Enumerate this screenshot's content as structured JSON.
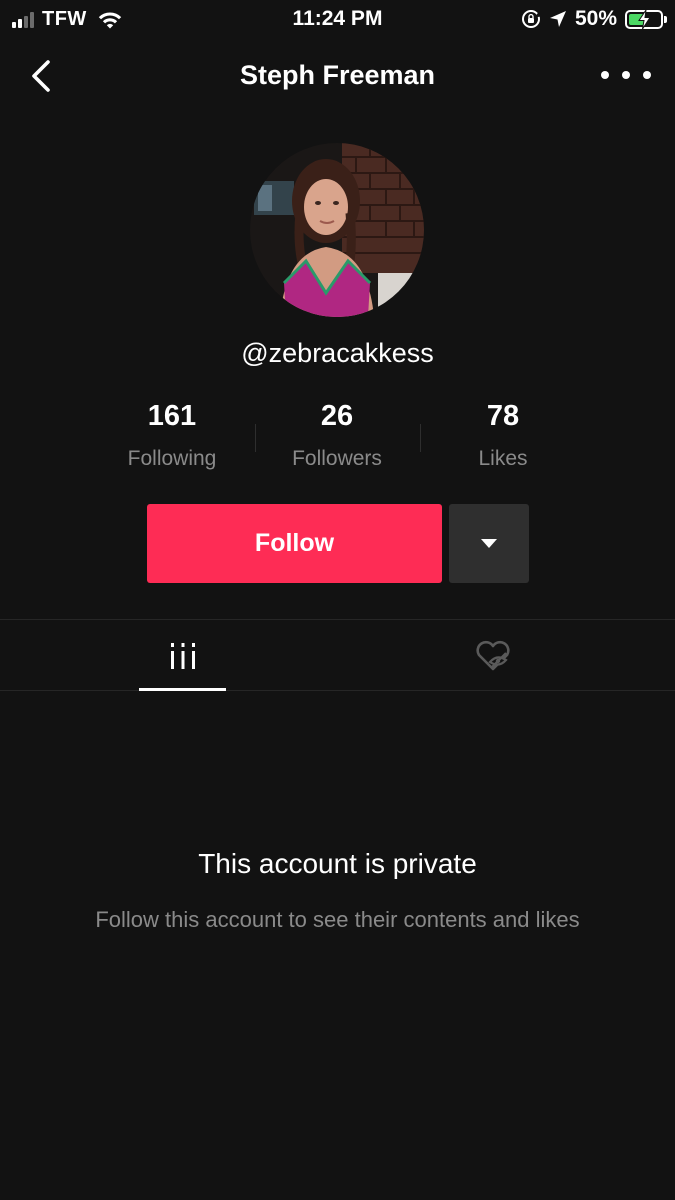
{
  "status_bar": {
    "carrier": "TFW",
    "time": "11:24 PM",
    "battery": "50%",
    "battery_level": 0.5,
    "icons": [
      "signal-icon",
      "wifi-icon",
      "rotation-lock-icon",
      "location-arrow-icon",
      "battery-charging-icon"
    ]
  },
  "header": {
    "title": "Steph Freeman",
    "back_icon": "chevron-left-icon",
    "more_icon": "more-horizontal-icon"
  },
  "profile": {
    "username": "@zebracakkess",
    "stats": [
      {
        "value": "161",
        "label": "Following"
      },
      {
        "value": "26",
        "label": "Followers"
      },
      {
        "value": "78",
        "label": "Likes"
      }
    ]
  },
  "actions": {
    "follow_label": "Follow",
    "dropdown_icon": "caret-down-icon"
  },
  "tabs": [
    {
      "icon": "video-grid-icon",
      "active": true
    },
    {
      "icon": "liked-private-icon",
      "active": false
    }
  ],
  "private_notice": {
    "title": "This account is private",
    "subtitle": "Follow this account to see their contents and likes"
  },
  "colors": {
    "background": "#121212",
    "accent": "#fe2c55",
    "secondary_button": "#2f2f2f",
    "muted_text": "#8a8a8a"
  }
}
